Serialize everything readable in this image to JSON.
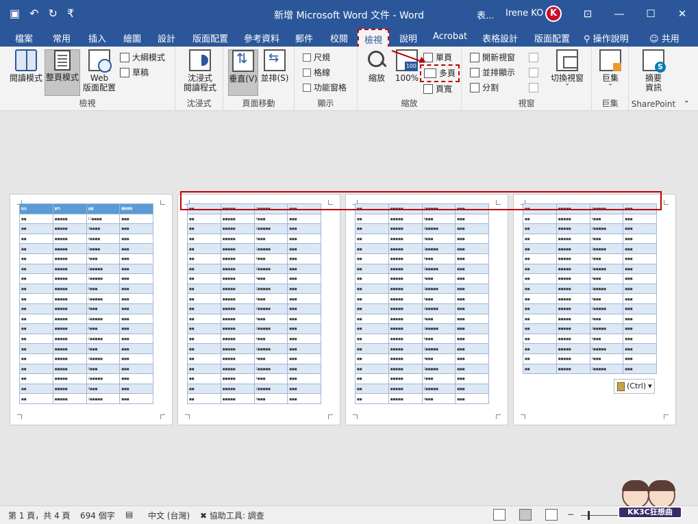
{
  "titlebar": {
    "doc_title": "新增 Microsoft Word 文件 - Word",
    "tab_short": "表...",
    "user_name": "Irene KO",
    "qat": [
      {
        "name": "save-icon",
        "glyph": "💾"
      },
      {
        "name": "undo-icon",
        "glyph": "↶"
      },
      {
        "name": "redo-icon",
        "glyph": "↻"
      },
      {
        "name": "customize-qat-icon",
        "glyph": "₹"
      }
    ],
    "window_buttons": [
      {
        "name": "ribbon-display-icon",
        "glyph": "⊡"
      },
      {
        "name": "minimize-icon",
        "glyph": "—"
      },
      {
        "name": "maximize-icon",
        "glyph": "☐"
      },
      {
        "name": "close-icon",
        "glyph": "✕"
      }
    ],
    "colors": {
      "bar": "#2b579a",
      "highlight": "#c00000"
    }
  },
  "tabs": [
    {
      "label": "檔案",
      "name": "tab-file"
    },
    {
      "label": "常用",
      "name": "tab-home"
    },
    {
      "label": "插入",
      "name": "tab-insert"
    },
    {
      "label": "繪圖",
      "name": "tab-draw"
    },
    {
      "label": "設計",
      "name": "tab-design"
    },
    {
      "label": "版面配置",
      "name": "tab-layout"
    },
    {
      "label": "參考資料",
      "name": "tab-references"
    },
    {
      "label": "郵件",
      "name": "tab-mailings"
    },
    {
      "label": "校閱",
      "name": "tab-review"
    },
    {
      "label": "檢視",
      "name": "tab-view",
      "active": true
    },
    {
      "label": "說明",
      "name": "tab-help"
    },
    {
      "label": "Acrobat",
      "name": "tab-acrobat"
    },
    {
      "label": "表格設計",
      "name": "tab-table-design"
    },
    {
      "label": "版面配置",
      "name": "tab-table-layout"
    }
  ],
  "tell_me": "操作說明",
  "share": "共用",
  "ribbon": {
    "views": {
      "label": "檢視",
      "read_mode": "閱讀模式",
      "print_layout": "整頁模式",
      "web_layout_1": "Web",
      "web_layout_2": "版面配置",
      "outline": "大綱模式",
      "draft": "草稿"
    },
    "immersive": {
      "label": "沈浸式",
      "reader_1": "沈浸式",
      "reader_2": "閱讀程式"
    },
    "page_movement": {
      "label": "頁面移動",
      "vertical": "垂直(V)",
      "side": "並排(S)"
    },
    "show": {
      "label": "顯示",
      "ruler": "尺規",
      "gridlines": "格線",
      "nav_pane": "功能窗格"
    },
    "zoom": {
      "label": "縮放",
      "zoom": "縮放",
      "percent": "100%",
      "one_page": "單頁",
      "multi_page": "多頁",
      "page_width": "頁寬"
    },
    "window": {
      "label": "視窗",
      "new_window": "開新視窗",
      "arrange_all": "並排顯示",
      "split": "分割",
      "switch_1": "切換視窗"
    },
    "macros": {
      "label": "巨集",
      "macros": "巨集"
    },
    "sharepoint": {
      "label": "SharePoint",
      "summary_1": "摘要",
      "summary_2": "資訊"
    }
  },
  "document": {
    "header_row": [
      "姓名",
      "部門",
      "金額",
      "備註說明"
    ],
    "page1_rows": [
      [
        "■■",
        "■■■■■",
        "11■■■■",
        "■■■"
      ],
      [
        "■■",
        "■■■■■",
        "3■■■■",
        "■■■"
      ],
      [
        "■■",
        "■■■■■",
        "6■■■■",
        "■■■"
      ],
      [
        "■■",
        "■■■■■",
        "5■■■■",
        "■■■"
      ],
      [
        "■■",
        "■■■■■",
        "9■■■",
        "■■■"
      ],
      [
        "■■",
        "■■■■■",
        "2■■■■■",
        "■■■"
      ],
      [
        "■■",
        "■■■■■",
        "2■■■■■",
        "■■■"
      ],
      [
        "■■",
        "■■■■■",
        "9■■■",
        "■■■"
      ],
      [
        "■■",
        "■■■■■",
        "2■■■■■",
        "■■■"
      ],
      [
        "■■",
        "■■■■■",
        "9■■■",
        "■■■"
      ],
      [
        "■■",
        "■■■■■",
        "2■■■■■",
        "■■■"
      ],
      [
        "■■",
        "■■■■■",
        "9■■■",
        "■■■"
      ],
      [
        "■■",
        "■■■■■",
        "2■■■■■",
        "■■■"
      ],
      [
        "■■",
        "■■■■■",
        "9■■■",
        "■■■"
      ],
      [
        "■■",
        "■■■■■",
        "2■■■■■",
        "■■■"
      ],
      [
        "■■",
        "■■■■■",
        "9■■■",
        "■■■"
      ],
      [
        "■■",
        "■■■■■",
        "2■■■■■",
        "■■■"
      ],
      [
        "■■",
        "■■■■■",
        "9■■■",
        "■■■"
      ],
      [
        "■■",
        "■■■■■",
        "2■■■■■",
        "■■■"
      ]
    ],
    "cont_row_a": [
      "■■",
      "■■■■■",
      "2■■■■■",
      "■■■"
    ],
    "cont_row_b": [
      "■■",
      "■■■■■",
      "9■■■",
      "■■■"
    ],
    "paste_ctrl": "(Ctrl)"
  },
  "statusbar": {
    "page": "第 1 頁，共 4 頁",
    "words": "694 個字",
    "language": "中文 (台灣)",
    "accessibility": "協助工具: 調查"
  },
  "logo": {
    "text": "KK3C狂想曲"
  }
}
